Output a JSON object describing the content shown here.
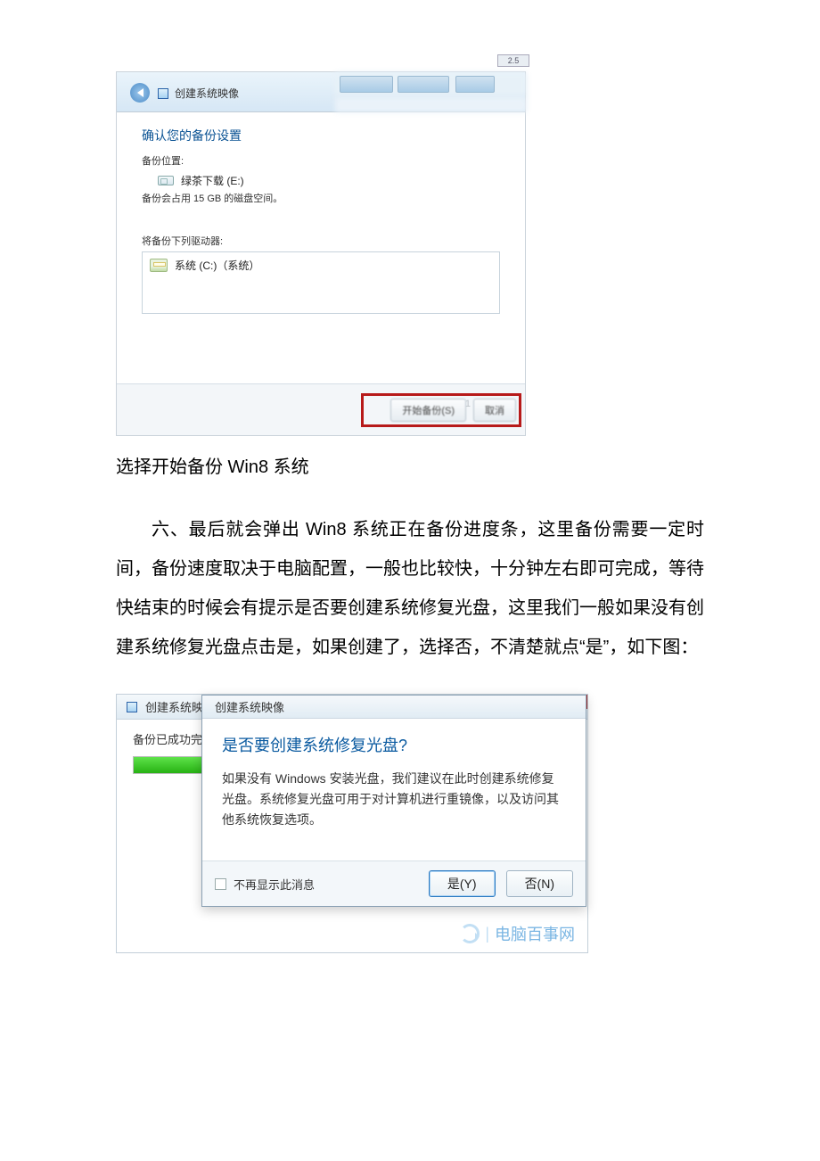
{
  "screenshot1": {
    "window_title": "创建系统映像",
    "section_heading": "确认您的备份设置",
    "location_label": "备份位置:",
    "drive_name": "绿茶下载 (E:)",
    "space_note": "备份会占用 15 GB 的磁盘空间。",
    "drives_label": "将备份下列驱动器:",
    "system_drive": "系统 (C:)（系统）",
    "start_button": "开始备份(S)",
    "cancel_button": "取消",
    "tag": "2.5"
  },
  "caption1": "选择开始备份 Win8 系统",
  "paragraph": "六、最后就会弹出 Win8 系统正在备份进度条，这里备份需要一定时间，备份速度取决于电脑配置，一般也比较快，十分钟左右即可完成，等待快结束的时候会有提示是否要创建系统修复光盘，这里我们一般如果没有创建系统修复光盘点击是，如果创建了，选择否，不清楚就点“是”，如下图：",
  "screenshot2": {
    "window_title": "创建系统映像",
    "status": "备份已成功完",
    "dialog": {
      "title": "创建系统映像",
      "question": "是否要创建系统修复光盘?",
      "body": "如果没有 Windows 安装光盘，我们建议在此时创建系统修复光盘。系统修复光盘可用于对计算机进行重镜像，以及访问其他系统恢复选项。",
      "checkbox": "不再显示此消息",
      "yes": "是(Y)",
      "no": "否(N)"
    },
    "watermark": "电脑百事网",
    "minimize": "—",
    "maximize": "□",
    "close": "×"
  }
}
